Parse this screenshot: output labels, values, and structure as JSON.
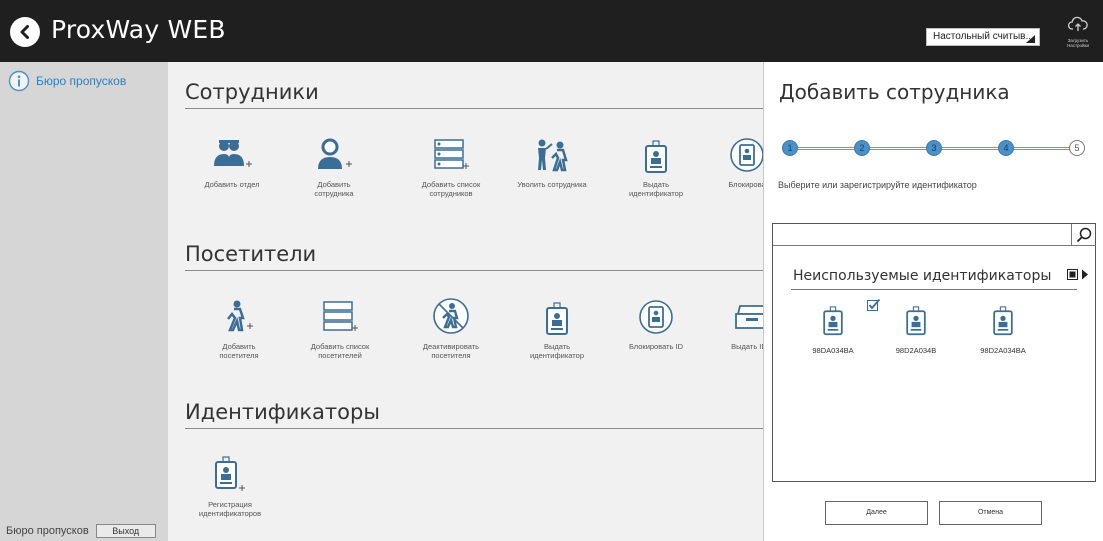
{
  "header": {
    "title": "ProxWay WEB",
    "reader_select": "Настольный считыв...",
    "cloud_label_1": "Загрузить",
    "cloud_label_2": "Настройки"
  },
  "sidebar": {
    "item_label": "Бюро пропусков",
    "footer_label": "Бюро пропусков",
    "exit_label": "Выход"
  },
  "main": {
    "sections": [
      {
        "title": "Сотрудники",
        "tiles": [
          {
            "line1": "Добавить отдел",
            "line2": "",
            "icon": "add-department-icon"
          },
          {
            "line1": "Добавить",
            "line2": "сотрудника",
            "icon": "add-employee-icon"
          },
          {
            "line1": "Добавить список",
            "line2": "сотрудников",
            "icon": "add-employee-list-icon"
          },
          {
            "line1": "Уволить сотрудника",
            "line2": "",
            "icon": "dismiss-employee-icon"
          },
          {
            "line1": "Выдать",
            "line2": "идентификатор",
            "icon": "id-badge-icon"
          },
          {
            "line1": "Блокирова",
            "line2": "",
            "icon": "block-id-icon"
          }
        ]
      },
      {
        "title": "Посетители",
        "tiles": [
          {
            "line1": "Добавить",
            "line2": "посетителя",
            "icon": "add-visitor-icon"
          },
          {
            "line1": "Добавить список",
            "line2": "посетителей",
            "icon": "add-visitor-list-icon"
          },
          {
            "line1": "Деактивировать",
            "line2": "посетителя",
            "icon": "deactivate-visitor-icon"
          },
          {
            "line1": "Выдать",
            "line2": "идентификатор",
            "icon": "id-badge-icon"
          },
          {
            "line1": "Блокировать ID",
            "line2": "",
            "icon": "block-id-icon"
          },
          {
            "line1": "Выдать ID в",
            "line2": "",
            "icon": "id-tray-icon"
          }
        ]
      },
      {
        "title": "Идентификаторы",
        "tiles": [
          {
            "line1": "Регистрация",
            "line2": "идентификаторов",
            "icon": "register-id-icon"
          }
        ]
      }
    ]
  },
  "panel": {
    "title": "Добавить сотрудника",
    "steps": [
      "1",
      "2",
      "3",
      "4",
      "5"
    ],
    "hint": "Выберите или зарегистрируйте идентификатор",
    "search_value": "",
    "list_title": "Неиспользуемые идентификаторы",
    "cards": [
      "98DA034BA",
      "98D2A034B",
      "98D2A034BA"
    ],
    "next_label": "Далее",
    "cancel_label": "Отмена"
  },
  "colors": {
    "header_bg": "#1f1f1f",
    "sidebar_bg": "#d6d6d6",
    "accent": "#4a90c9",
    "icon_blue": "#3c6e95"
  }
}
